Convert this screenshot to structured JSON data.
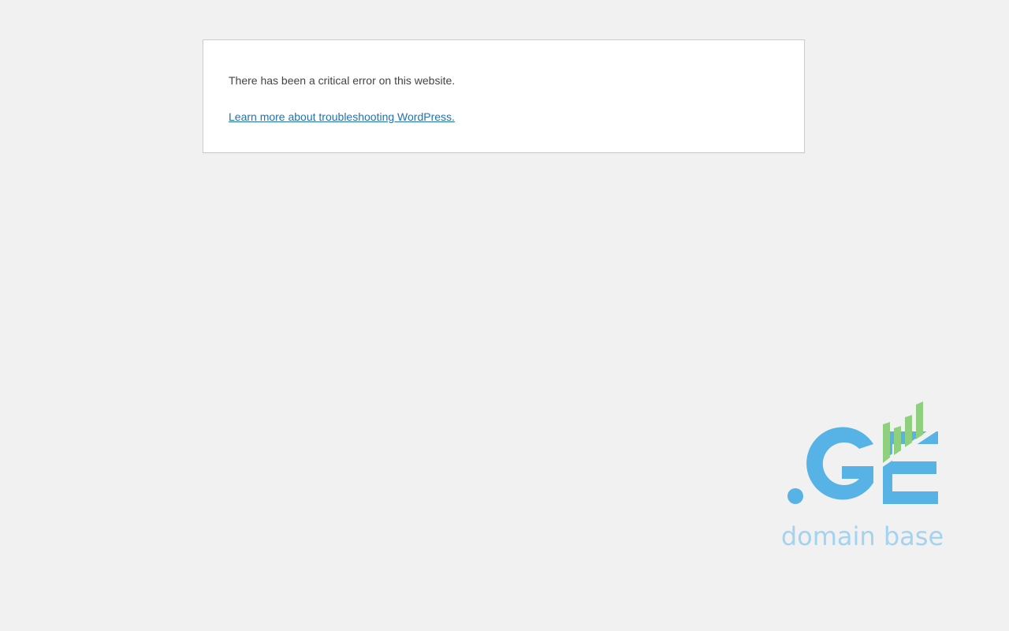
{
  "error": {
    "message": "There has been a critical error on this website.",
    "help_link_text": "Learn more about troubleshooting WordPress."
  },
  "logo": {
    "brand_mark": ".GE",
    "tagline": "domain base",
    "icon": "ge-domain-base-logo",
    "colors": {
      "blue": "#57b3e6",
      "green": "#8fd07f",
      "tagline": "#a3d3ef"
    }
  },
  "colors": {
    "background": "#f1f1f1",
    "panel": "#ffffff",
    "text": "#444444",
    "link": "#2271b1"
  }
}
